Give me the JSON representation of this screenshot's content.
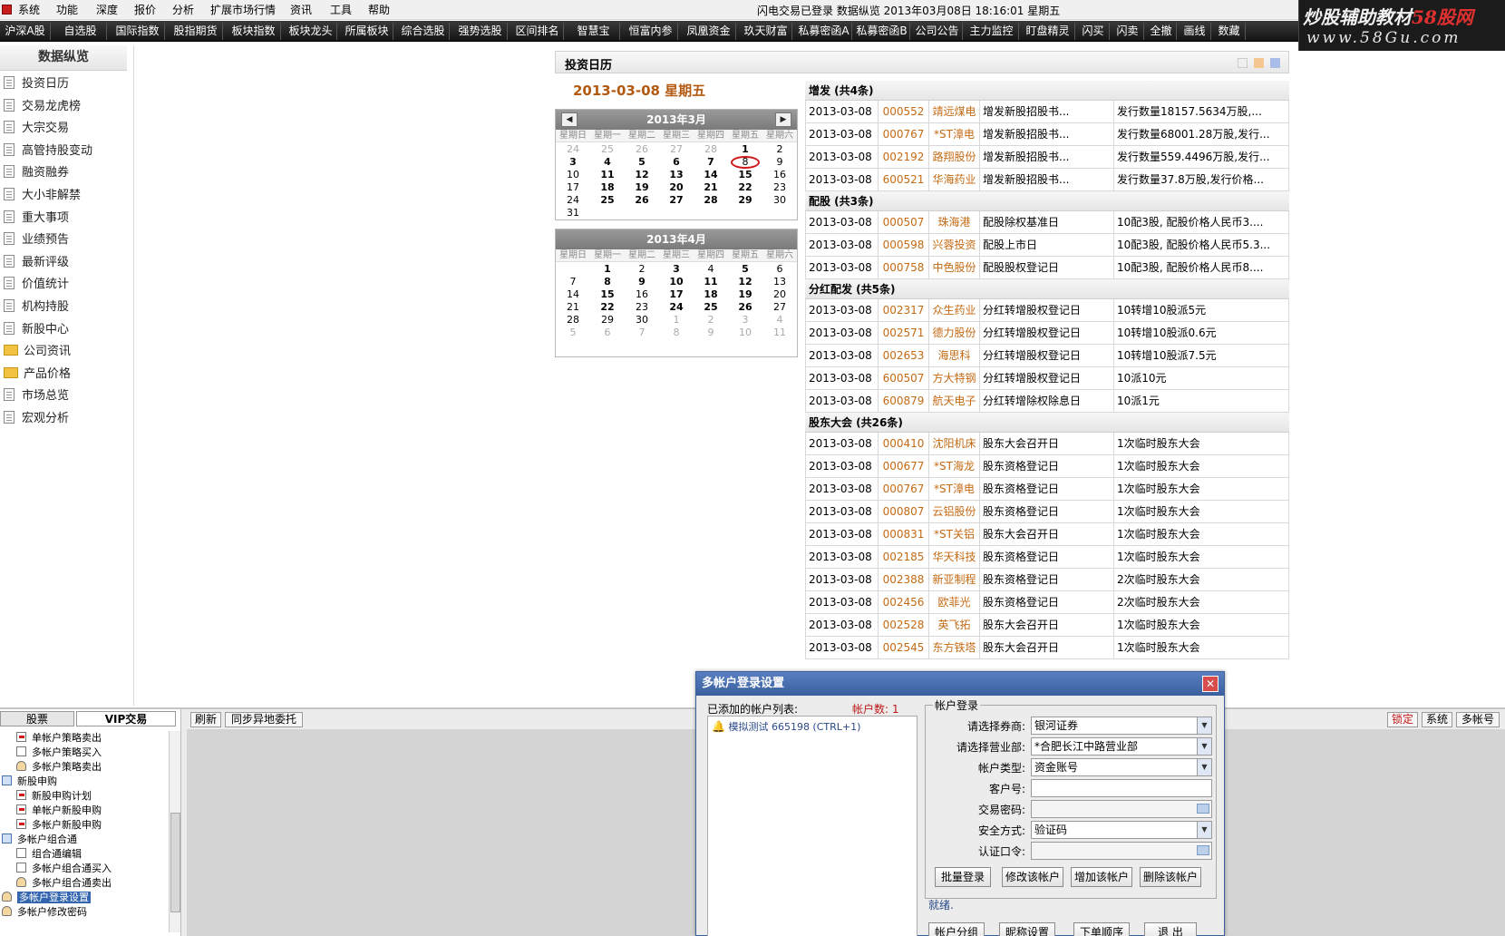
{
  "menubar": {
    "items": [
      "系统",
      "功能",
      "深度",
      "报价",
      "分析",
      "扩展市场行情",
      "资讯",
      "工具",
      "帮助"
    ],
    "title": "闪电交易已登录  数据纵览 2013年03月08日 18:16:01 星期五"
  },
  "logo": {
    "line1_a": "炒股辅助教材",
    "line1_b": "58股网",
    "line2": "www.58Gu.com"
  },
  "toolbar": {
    "items": [
      "沪深A股",
      "自选股",
      "国际指数",
      "股指期货",
      "板块指数",
      "板块龙头",
      "所属板块",
      "综合选股",
      "强势选股",
      "区间排名",
      "智慧宝",
      "恒富内参",
      "凤凰资金",
      "玖天财富",
      "私募密函A",
      "私募密函B",
      "公司公告",
      "主力监控",
      "盯盘精灵",
      "闪买",
      "闪卖",
      "全撤",
      "画线",
      "数藏"
    ]
  },
  "sidebar": {
    "title": "数据纵览",
    "items": [
      {
        "label": "投资日历",
        "icon": "doc"
      },
      {
        "label": "交易龙虎榜",
        "icon": "doc"
      },
      {
        "label": "大宗交易",
        "icon": "doc"
      },
      {
        "label": "高管持股变动",
        "icon": "doc"
      },
      {
        "label": "融资融券",
        "icon": "doc"
      },
      {
        "label": "大小非解禁",
        "icon": "doc"
      },
      {
        "label": "重大事项",
        "icon": "doc"
      },
      {
        "label": "业绩预告",
        "icon": "doc"
      },
      {
        "label": "最新评级",
        "icon": "doc"
      },
      {
        "label": "价值统计",
        "icon": "doc"
      },
      {
        "label": "机构持股",
        "icon": "doc"
      },
      {
        "label": "新股中心",
        "icon": "doc"
      },
      {
        "label": "公司资讯",
        "icon": "folder"
      },
      {
        "label": "产品价格",
        "icon": "folder"
      },
      {
        "label": "市场总览",
        "icon": "doc"
      },
      {
        "label": "宏观分析",
        "icon": "doc"
      }
    ]
  },
  "panel": {
    "title": "投资日历",
    "date": "2013-03-08  星期五",
    "swatch_colors": [
      "#f0f0f0",
      "#f5c892",
      "#a9bde8"
    ]
  },
  "calendar": {
    "weekdays": [
      "星期日",
      "星期一",
      "星期二",
      "星期三",
      "星期四",
      "星期五",
      "星期六"
    ],
    "months": [
      {
        "title": "2013年3月",
        "rows": [
          [
            "24",
            "25",
            "26",
            "27",
            "28",
            "1",
            "2"
          ],
          [
            "3",
            "4",
            "5",
            "6",
            "7",
            "8",
            "9"
          ],
          [
            "10",
            "11",
            "12",
            "13",
            "14",
            "15",
            "16"
          ],
          [
            "17",
            "18",
            "19",
            "20",
            "21",
            "22",
            "23"
          ],
          [
            "24",
            "25",
            "26",
            "27",
            "28",
            "29",
            "30"
          ],
          [
            "31",
            "",
            "",
            "",
            "",
            "",
            ""
          ]
        ],
        "other": [
          [
            0,
            0
          ],
          [
            0,
            1
          ],
          [
            0,
            2
          ],
          [
            0,
            3
          ],
          [
            0,
            4
          ]
        ],
        "selected": [
          1,
          5
        ],
        "bold": [
          [
            0,
            5
          ],
          [
            1,
            0
          ],
          [
            1,
            1
          ],
          [
            1,
            2
          ],
          [
            1,
            3
          ],
          [
            1,
            4
          ],
          [
            2,
            1
          ],
          [
            2,
            2
          ],
          [
            2,
            3
          ],
          [
            2,
            4
          ],
          [
            2,
            5
          ],
          [
            3,
            1
          ],
          [
            3,
            2
          ],
          [
            3,
            3
          ],
          [
            3,
            4
          ],
          [
            3,
            5
          ],
          [
            4,
            1
          ],
          [
            4,
            2
          ],
          [
            4,
            3
          ],
          [
            4,
            4
          ],
          [
            4,
            5
          ]
        ]
      },
      {
        "title": "2013年4月",
        "rows": [
          [
            "",
            "1",
            "2",
            "3",
            "4",
            "5",
            "6"
          ],
          [
            "7",
            "8",
            "9",
            "10",
            "11",
            "12",
            "13"
          ],
          [
            "14",
            "15",
            "16",
            "17",
            "18",
            "19",
            "20"
          ],
          [
            "21",
            "22",
            "23",
            "24",
            "25",
            "26",
            "27"
          ],
          [
            "28",
            "29",
            "30",
            "1",
            "2",
            "3",
            "4"
          ],
          [
            "5",
            "6",
            "7",
            "8",
            "9",
            "10",
            "11"
          ]
        ],
        "other": [
          [
            4,
            3
          ],
          [
            4,
            4
          ],
          [
            4,
            5
          ],
          [
            4,
            6
          ],
          [
            5,
            0
          ],
          [
            5,
            1
          ],
          [
            5,
            2
          ],
          [
            5,
            3
          ],
          [
            5,
            4
          ],
          [
            5,
            5
          ],
          [
            5,
            6
          ]
        ],
        "selected": null,
        "bold": [
          [
            0,
            1
          ],
          [
            0,
            3
          ],
          [
            0,
            5
          ],
          [
            1,
            1
          ],
          [
            1,
            2
          ],
          [
            1,
            3
          ],
          [
            1,
            4
          ],
          [
            1,
            5
          ],
          [
            2,
            1
          ],
          [
            2,
            3
          ],
          [
            2,
            4
          ],
          [
            2,
            5
          ],
          [
            3,
            1
          ],
          [
            3,
            3
          ],
          [
            3,
            4
          ],
          [
            3,
            5
          ]
        ]
      }
    ]
  },
  "events": [
    {
      "title": "增发 (共4条)",
      "rows": [
        [
          "2013-03-08",
          "000552",
          "靖远煤电",
          "增发新股招股书...",
          "发行数量18157.5634万股,..."
        ],
        [
          "2013-03-08",
          "000767",
          "*ST漳电",
          "增发新股招股书...",
          "发行数量68001.28万股,发行..."
        ],
        [
          "2013-03-08",
          "002192",
          "路翔股份",
          "增发新股招股书...",
          "发行数量559.4496万股,发行..."
        ],
        [
          "2013-03-08",
          "600521",
          "华海药业",
          "增发新股招股书...",
          "发行数量37.8万股,发行价格..."
        ]
      ]
    },
    {
      "title": "配股 (共3条)",
      "rows": [
        [
          "2013-03-08",
          "000507",
          "珠海港",
          "配股除权基准日",
          "10配3股, 配股价格人民币3...."
        ],
        [
          "2013-03-08",
          "000598",
          "兴蓉投资",
          "配股上市日",
          "10配3股, 配股价格人民币5.3..."
        ],
        [
          "2013-03-08",
          "000758",
          "中色股份",
          "配股股权登记日",
          "10配3股, 配股价格人民币8...."
        ]
      ]
    },
    {
      "title": "分红配发 (共5条)",
      "rows": [
        [
          "2013-03-08",
          "002317",
          "众生药业",
          "分红转增股权登记日",
          "10转增10股派5元"
        ],
        [
          "2013-03-08",
          "002571",
          "德力股份",
          "分红转增股权登记日",
          "10转增10股派0.6元"
        ],
        [
          "2013-03-08",
          "002653",
          "海思科",
          "分红转增股权登记日",
          "10转增10股派7.5元"
        ],
        [
          "2013-03-08",
          "600507",
          "方大特钢",
          "分红转增股权登记日",
          "10派10元"
        ],
        [
          "2013-03-08",
          "600879",
          "航天电子",
          "分红转增除权除息日",
          "10派1元"
        ]
      ]
    },
    {
      "title": "股东大会 (共26条)",
      "rows": [
        [
          "2013-03-08",
          "000410",
          "沈阳机床",
          "股东大会召开日",
          "1次临时股东大会"
        ],
        [
          "2013-03-08",
          "000677",
          "*ST海龙",
          "股东资格登记日",
          "1次临时股东大会"
        ],
        [
          "2013-03-08",
          "000767",
          "*ST漳电",
          "股东资格登记日",
          "1次临时股东大会"
        ],
        [
          "2013-03-08",
          "000807",
          "云铝股份",
          "股东资格登记日",
          "1次临时股东大会"
        ],
        [
          "2013-03-08",
          "000831",
          "*ST关铝",
          "股东大会召开日",
          "1次临时股东大会"
        ],
        [
          "2013-03-08",
          "002185",
          "华天科技",
          "股东资格登记日",
          "1次临时股东大会"
        ],
        [
          "2013-03-08",
          "002388",
          "新亚制程",
          "股东资格登记日",
          "2次临时股东大会"
        ],
        [
          "2013-03-08",
          "002456",
          "欧菲光",
          "股东资格登记日",
          "2次临时股东大会"
        ],
        [
          "2013-03-08",
          "002528",
          "英飞拓",
          "股东大会召开日",
          "1次临时股东大会"
        ],
        [
          "2013-03-08",
          "002545",
          "东方铁塔",
          "股东大会召开日",
          "1次临时股东大会"
        ]
      ]
    }
  ],
  "bottom": {
    "tabs": [
      "股票",
      "VIP交易"
    ],
    "tree": [
      {
        "label": "单帐户策略卖出",
        "level": 1,
        "icon": "red"
      },
      {
        "label": "多帐户策略买入",
        "level": 1,
        "icon": "grid"
      },
      {
        "label": "多帐户策略卖出",
        "level": 1,
        "icon": "person"
      },
      {
        "label": "新股申购",
        "level": 0,
        "icon": "folder"
      },
      {
        "label": "新股申购计划",
        "level": 1,
        "icon": "red"
      },
      {
        "label": "单帐户新股申购",
        "level": 1,
        "icon": "red"
      },
      {
        "label": "多帐户新股申购",
        "level": 1,
        "icon": "red"
      },
      {
        "label": "多帐户组合通",
        "level": 0,
        "icon": "folder"
      },
      {
        "label": "组合通编辑",
        "level": 1,
        "icon": "grid"
      },
      {
        "label": "多帐户组合通买入",
        "level": 1,
        "icon": "grid"
      },
      {
        "label": "多帐户组合通卖出",
        "level": 1,
        "icon": "person"
      },
      {
        "label": "多帐户登录设置",
        "level": 0,
        "icon": "person",
        "selected": true
      },
      {
        "label": "多帐户修改密码",
        "level": 0,
        "icon": "person"
      }
    ],
    "buttons": {
      "refresh": "刷新",
      "sync": "同步异地委托"
    },
    "right_buttons": [
      "锁定",
      "系统",
      "多帐号"
    ]
  },
  "dialog": {
    "title": "多帐户登录设置",
    "list_label": "已添加的帐户列表:",
    "count_label": "帐户数: 1",
    "account_entry": "模拟测试 665198 (CTRL+1)",
    "login_legend": "帐户登录",
    "fields": [
      {
        "label": "请选择券商:",
        "value": "银河证券",
        "type": "select"
      },
      {
        "label": "请选择营业部:",
        "value": "*合肥长江中路营业部",
        "type": "select"
      },
      {
        "label": "帐户类型:",
        "value": "资金账号",
        "type": "select"
      },
      {
        "label": "客户号:",
        "value": "",
        "type": "text"
      },
      {
        "label": "交易密码:",
        "value": "",
        "type": "password"
      },
      {
        "label": "安全方式:",
        "value": "验证码",
        "type": "select"
      },
      {
        "label": "认证口令:",
        "value": "",
        "type": "password"
      }
    ],
    "actions": [
      "批量登录",
      "修改该帐户",
      "增加该帐户",
      "删除该帐户"
    ],
    "status": "就绪.",
    "footer": [
      "帐户分组",
      "昵称设置",
      "下单顺序",
      "退 出"
    ]
  }
}
